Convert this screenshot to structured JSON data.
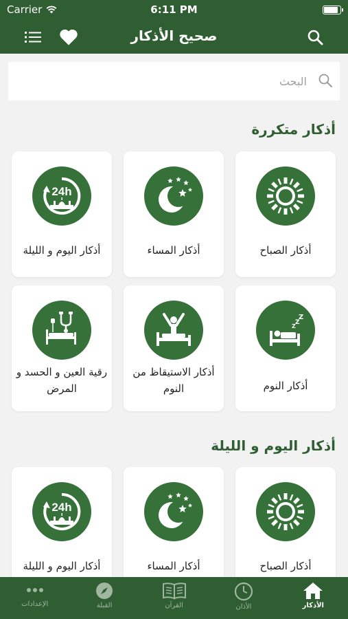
{
  "status_bar": {
    "carrier": "Carrier",
    "time": "6:11 PM",
    "battery_level": 0.95
  },
  "nav": {
    "title": "صحيح الأذكار"
  },
  "search": {
    "placeholder": "البحث"
  },
  "sections": [
    {
      "title": "أذكار متكررة",
      "cards": [
        {
          "label": "أذكار الصباح",
          "icon": "sun-icon"
        },
        {
          "label": "أذكار المساء",
          "icon": "moon-stars-icon"
        },
        {
          "label": "أذكار اليوم و الليلة",
          "icon": "24h-mosque-icon"
        },
        {
          "label": "أذكار النوم",
          "icon": "sleeping-bed-icon"
        },
        {
          "label": "أذكار الاستيقاظ من النوم",
          "icon": "waking-up-icon"
        },
        {
          "label": "رقية العين و الحسد و المرض",
          "icon": "hospital-bed-stethoscope-icon"
        }
      ]
    },
    {
      "title": "أذكار اليوم و الليلة",
      "cards": [
        {
          "label": "أذكار الصباح",
          "icon": "sun-icon"
        },
        {
          "label": "أذكار المساء",
          "icon": "moon-stars-icon"
        },
        {
          "label": "أذكار اليوم و الليلة",
          "icon": "24h-mosque-icon"
        }
      ]
    }
  ],
  "tabs": [
    {
      "label": "الأذكار",
      "icon": "home-icon",
      "active": true
    },
    {
      "label": "الأذان",
      "icon": "clock-icon",
      "active": false
    },
    {
      "label": "القرآن",
      "icon": "book-icon",
      "active": false
    },
    {
      "label": "القبلة",
      "icon": "compass-icon",
      "active": false
    },
    {
      "label": "الإعدادات",
      "icon": "more-icon",
      "active": false
    }
  ],
  "colors": {
    "primary": "#2f5e32",
    "icon_circle": "#36713a",
    "background": "#f2f2f2",
    "card": "#ffffff"
  }
}
